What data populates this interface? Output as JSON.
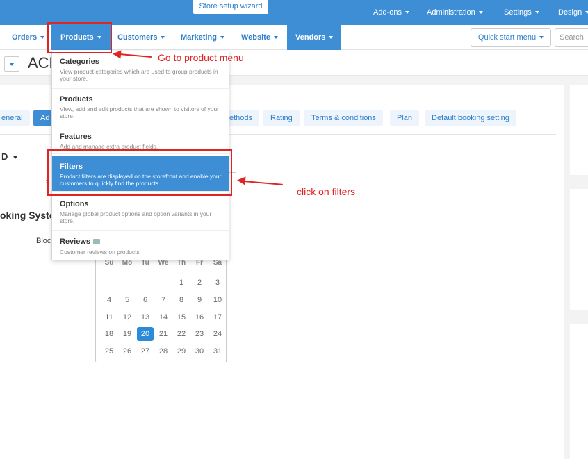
{
  "topbar": {
    "wizard_label": "Store setup wizard",
    "menus": [
      "Add-ons",
      "Administration",
      "Settings",
      "Design"
    ]
  },
  "navbar": {
    "items": [
      "Orders",
      "Products",
      "Customers",
      "Marketing",
      "Website",
      "Vendors"
    ],
    "quick_start": "Quick start menu",
    "search_placeholder": "Search"
  },
  "header": {
    "title": "ACM"
  },
  "tabs": [
    "eneral",
    "Ad",
    "ethods",
    "Rating",
    "Terms & conditions",
    "Plan",
    "Default booking setting"
  ],
  "content": {
    "section_toggle": "D",
    "field_s": "s",
    "section_heading": "oking Syste",
    "field_b": "Bloc"
  },
  "calendar": {
    "weekdays": [
      "Su",
      "Mo",
      "Tu",
      "We",
      "Th",
      "Fr",
      "Sa"
    ],
    "weeks": [
      [
        "",
        "",
        "",
        "",
        "1",
        "2",
        "3"
      ],
      [
        "4",
        "5",
        "6",
        "7",
        "8",
        "9",
        "10"
      ],
      [
        "11",
        "12",
        "13",
        "14",
        "15",
        "16",
        "17"
      ],
      [
        "18",
        "19",
        "20",
        "21",
        "22",
        "23",
        "24"
      ],
      [
        "25",
        "26",
        "27",
        "28",
        "29",
        "30",
        "31"
      ]
    ],
    "today": "20"
  },
  "dropdown": {
    "items": [
      {
        "title": "Categories",
        "desc": "View product categories which are used to group products in your store."
      },
      {
        "title": "Products",
        "desc": "View, add and edit products that are shown to visitors of your store."
      },
      {
        "title": "Features",
        "desc": "Add and manage extra product fields."
      },
      {
        "title": "Filters",
        "desc": "Product filters are displayed on the storefront and enable your customers to quickly find the products."
      },
      {
        "title": "Options",
        "desc": "Manage global product options and option variants in your store."
      },
      {
        "title": "Reviews",
        "desc": "Customer reviews on products"
      }
    ]
  },
  "annotations": {
    "product_menu": "Go to product menu",
    "filters": "click on filters"
  },
  "colors": {
    "accent": "#3d8ed5",
    "annotation": "#e02424"
  }
}
